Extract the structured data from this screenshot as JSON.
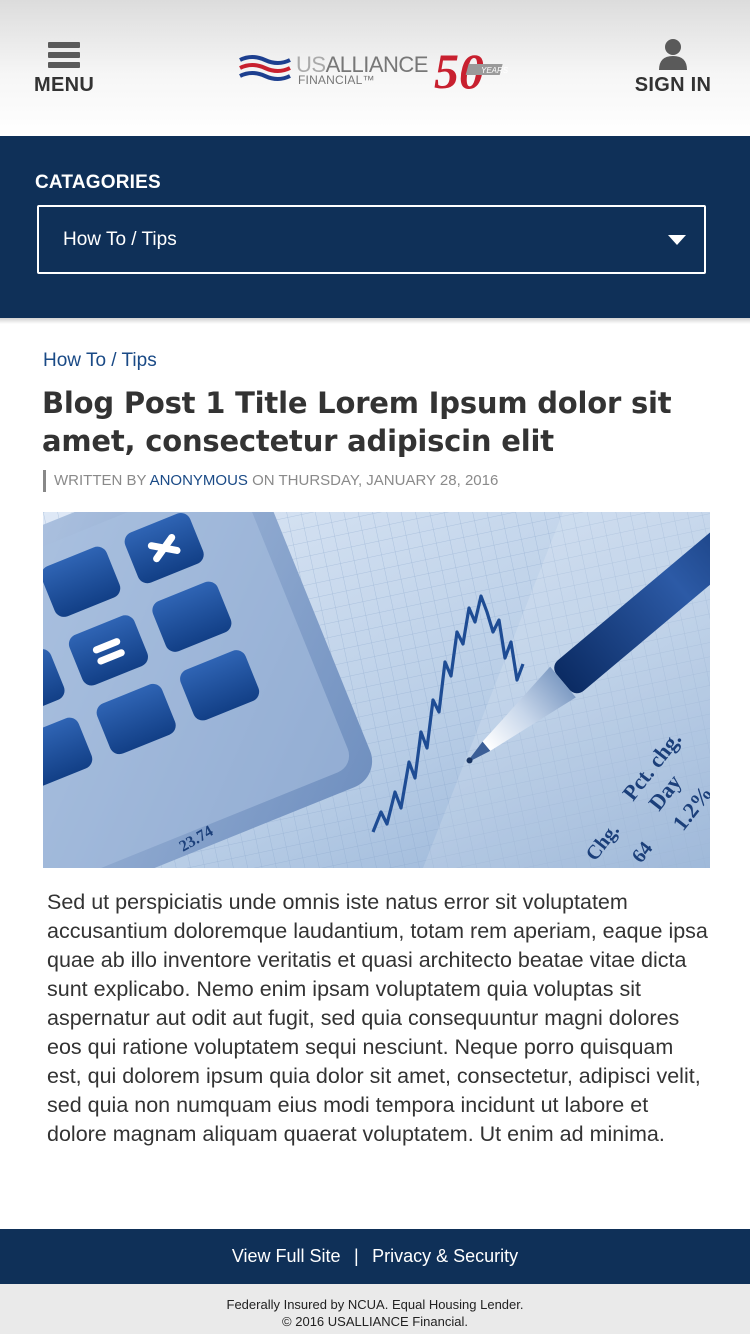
{
  "header": {
    "menu_label": "MENU",
    "signin_label": "SIGN IN",
    "logo": {
      "brand_us": "US",
      "brand_alliance": "ALLIANCE",
      "brand_financial": "FINANCIAL™",
      "anniversary_number": "50",
      "anniversary_word": "YEARS"
    }
  },
  "categories": {
    "heading": "CATAGORIES",
    "selected": "How To / Tips"
  },
  "article": {
    "breadcrumb": "How To / Tips",
    "title": "Blog Post 1 Title Lorem Ipsum dolor sit amet, consectetur adipiscin elit",
    "byline": {
      "written_by": "WRITTEN BY",
      "author": "ANONYMOUS",
      "on_date": "ON THURSDAY, JANUARY 28, 2016"
    },
    "hero_labels": {
      "pct_chg": "Pct. chg.",
      "day": "Day",
      "chg": "Chg.",
      "pct_value": "1.2%",
      "left_value": "23.74",
      "bottom_value": "64"
    },
    "body": "Sed ut perspiciatis unde omnis iste natus error sit voluptatem accusantium doloremque laudantium, totam rem aperiam, eaque ipsa quae ab illo inventore veritatis et quasi architecto beatae vitae dicta sunt explicabo. Nemo enim ipsam voluptatem quia voluptas sit aspernatur aut odit aut fugit, sed quia consequuntur magni dolores eos qui ratione voluptatem sequi nesciunt. Neque porro quisquam est, qui dolorem ipsum quia dolor sit amet, consectetur, adipisci velit, sed quia non numquam eius modi tempora incidunt ut labore et dolore magnam aliquam quaerat voluptatem. Ut enim ad minima."
  },
  "footer": {
    "view_full_site": "View Full Site",
    "separator": "|",
    "privacy": "Privacy & Security",
    "legal_line1": "Federally Insured by NCUA. Equal Housing Lender.",
    "legal_line2": "© 2016 USALLIANCE Financial."
  },
  "colors": {
    "navy": "#0f3058",
    "link_blue": "#1a4a86",
    "logo_red": "#c8202f",
    "logo_blue": "#1d3f8f"
  }
}
